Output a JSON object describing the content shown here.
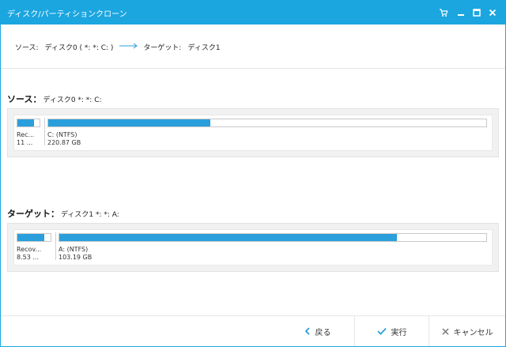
{
  "window": {
    "title": "ディスク/パーティションクローン",
    "controls": [
      "cart-icon",
      "minimize-icon",
      "maximize-icon",
      "close-icon"
    ]
  },
  "summary": {
    "source_label": "ソース:",
    "source_value": "ディスク0 ( *: *: C: )",
    "target_label": "ターゲット:",
    "target_value": "ディスク1"
  },
  "source_section": {
    "head": "ソース：",
    "sub": "ディスク0 *: *: C:",
    "partitions": [
      {
        "name": "Rec...",
        "size": "11 ...",
        "used_fraction": 0.75
      },
      {
        "name": "C: (NTFS)",
        "size": "220.87 GB",
        "used_fraction": 0.37
      }
    ]
  },
  "target_section": {
    "head": "ターゲット：",
    "sub": "ディスク1 *: *: A:",
    "partitions": [
      {
        "name": "Recov...",
        "size": "8.53 ...",
        "used_fraction": 0.8
      },
      {
        "name": "A: (NTFS)",
        "size": "103.19 GB",
        "used_fraction": 0.79
      }
    ]
  },
  "footer": {
    "back_label": "戻る",
    "execute_label": "実行",
    "cancel_label": "キャンセル"
  },
  "colors": {
    "accent": "#1ba6e0",
    "bar_fill": "#2a9fdc",
    "panel_bg": "#f1f1f1",
    "execute_icon": "#2a9fdc"
  }
}
